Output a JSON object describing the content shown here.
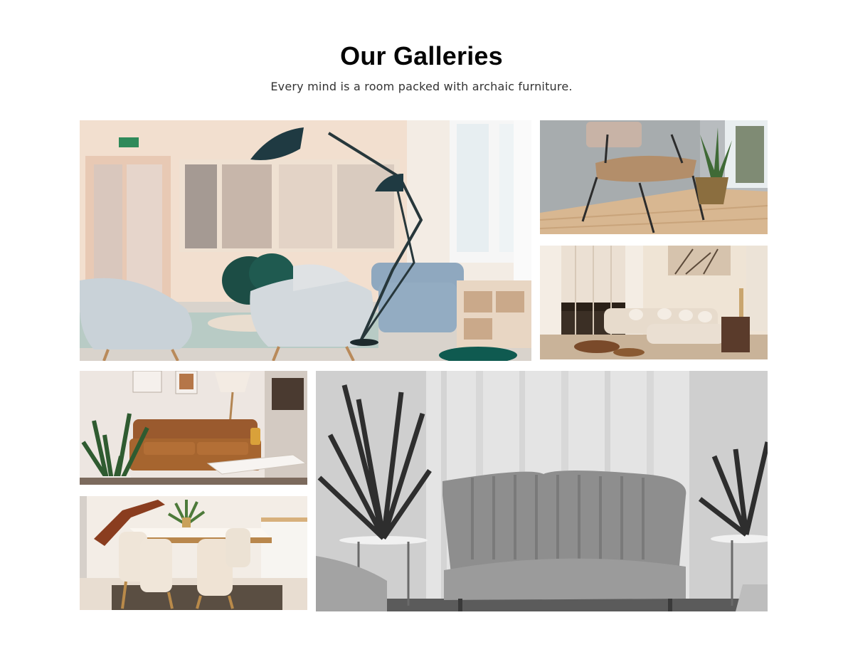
{
  "gallery": {
    "title": "Our Galleries",
    "subtitle": "Every mind is a room packed with archaic furniture."
  },
  "photos": [
    {
      "subject": "bright living room with white chairs, floor lamp and blue sofa"
    },
    {
      "subject": "lounge chair with potted snake plant"
    },
    {
      "subject": "beige sectional sofa with curtains"
    },
    {
      "subject": "brown leather sofa with plant and floor lamp"
    },
    {
      "subject": "dining table with cream chairs"
    },
    {
      "subject": "grey channel-tufted sofa with palm plants"
    }
  ],
  "colors": {
    "text": "#050505",
    "subtext": "#333333",
    "background": "#ffffff"
  }
}
